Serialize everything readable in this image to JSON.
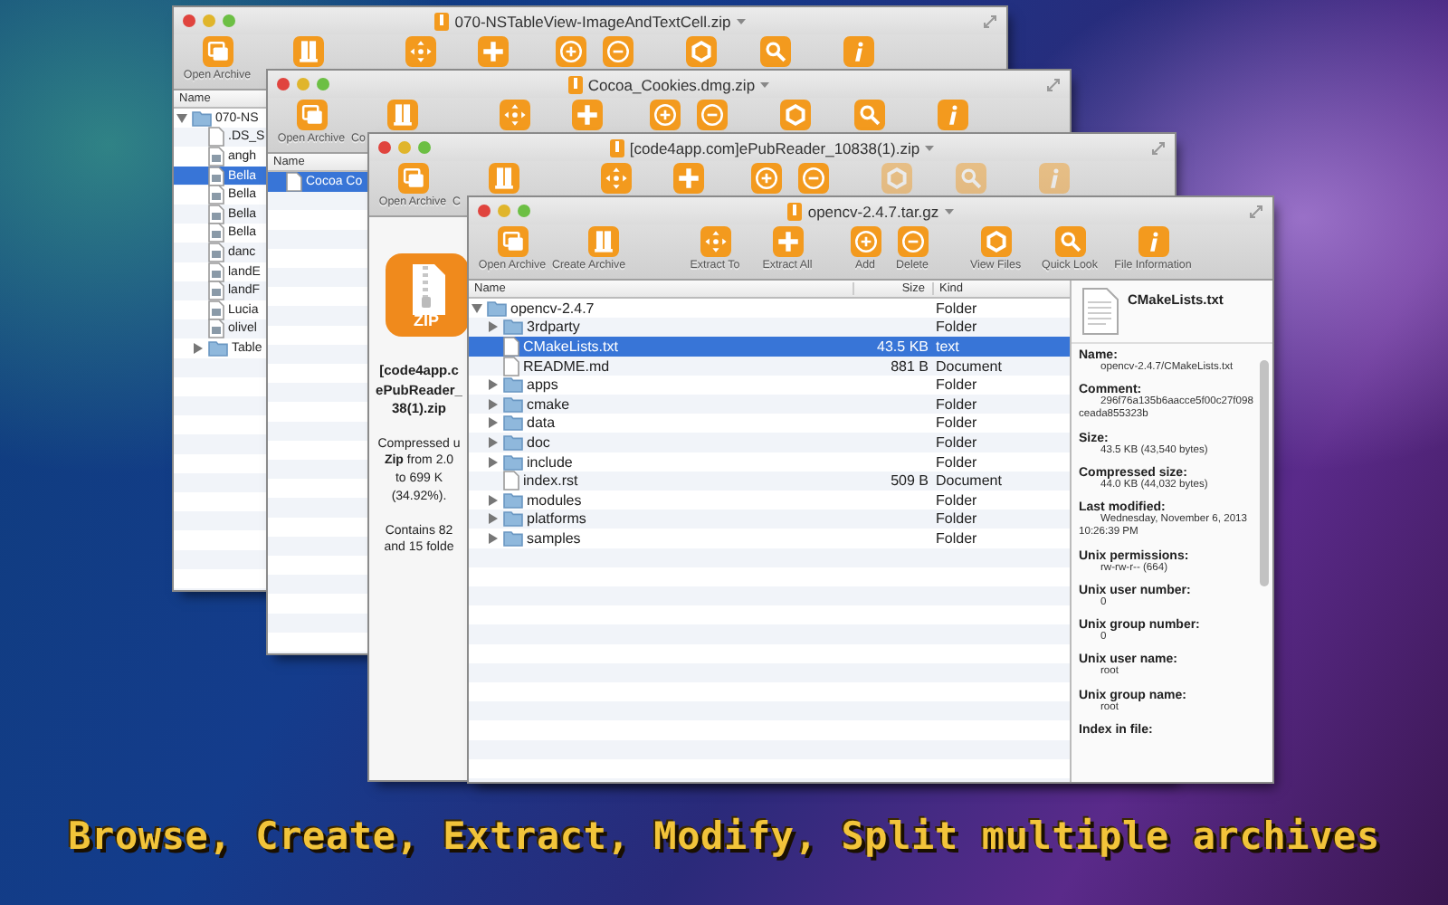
{
  "windows": [
    {
      "title": "070-NSTableView-ImageAndTextCell.zip",
      "toolbar": [
        [
          {
            "label": "Open Archive",
            "disabled": false
          },
          {
            "disabled": false
          }
        ],
        [
          {
            "disabled": false
          },
          {
            "disabled": false
          }
        ],
        [
          {
            "disabled": false
          },
          {
            "disabled": false
          }
        ],
        [
          {
            "disabled": false
          },
          {
            "disabled": false
          },
          {
            "disabled": false
          }
        ]
      ],
      "body": {
        "kind": "tree",
        "columns": [
          "Name"
        ],
        "rows": [
          {
            "name": "070-NS",
            "kind": "folder",
            "expanded": true,
            "selected": false,
            "children": [
              {
                "name": ".DS_S",
                "kind": "file",
                "selected": false
              },
              {
                "name": "angh",
                "kind": "image",
                "selected": false
              },
              {
                "name": "Bella",
                "kind": "image",
                "selected": true
              },
              {
                "name": "Bella",
                "kind": "image",
                "selected": false
              },
              {
                "name": "Bella",
                "kind": "image",
                "selected": false
              },
              {
                "name": "Bella",
                "kind": "image",
                "selected": false
              },
              {
                "name": "danc",
                "kind": "image",
                "selected": false
              },
              {
                "name": "landE",
                "kind": "image",
                "selected": false
              },
              {
                "name": "landF",
                "kind": "image",
                "selected": false
              },
              {
                "name": "Lucia",
                "kind": "image",
                "selected": false
              },
              {
                "name": "olivel",
                "kind": "image",
                "selected": false
              },
              {
                "name": "Table",
                "kind": "folder",
                "expanded": false,
                "selected": false
              }
            ]
          }
        ]
      }
    },
    {
      "title": "Cocoa_Cookies.dmg.zip",
      "toolbar": [
        [
          {
            "label": "Open Archive",
            "disabled": false
          },
          {
            "label": "Co",
            "disabled": false
          }
        ],
        [
          {
            "disabled": false
          },
          {
            "disabled": false
          }
        ],
        [
          {
            "disabled": false
          },
          {
            "disabled": false
          }
        ],
        [
          {
            "disabled": false
          },
          {
            "disabled": false
          },
          {
            "disabled": false
          }
        ]
      ],
      "body": {
        "kind": "tree",
        "columns": [
          "Name"
        ],
        "rows": [
          {
            "name": "Cocoa Co",
            "kind": "file",
            "selected": true
          }
        ]
      }
    },
    {
      "title": "[code4app.com]ePubReader_10838(1).zip",
      "toolbar": [
        [
          {
            "label": "Open Archive",
            "disabled": false
          },
          {
            "label": "C",
            "disabled": false
          }
        ],
        [
          {
            "disabled": false
          },
          {
            "disabled": false
          }
        ],
        [
          {
            "disabled": false
          },
          {
            "disabled": false
          }
        ],
        [
          {
            "disabled": true
          },
          {
            "disabled": true
          },
          {
            "disabled": true
          }
        ]
      ],
      "body": {
        "kind": "summary",
        "icon_label": "ZIP",
        "title_lines": [
          "[code4app.c",
          "ePubReader_",
          "38(1).zip"
        ],
        "paragraphs": [
          [
            "Compressed u",
            "**Zip** from 2.0",
            "to 699 K",
            "(34.92%)."
          ],
          [
            "Contains 82",
            "and 15 folde"
          ]
        ]
      }
    },
    {
      "title": "opencv-2.4.7.tar.gz",
      "toolbar": [
        [
          {
            "label": "Open Archive",
            "disabled": false
          },
          {
            "label": "Create Archive",
            "disabled": false
          }
        ],
        [
          {
            "label": "Extract To",
            "disabled": false
          },
          {
            "label": "Extract All",
            "disabled": false
          }
        ],
        [
          {
            "label": "Add",
            "disabled": false
          },
          {
            "label": "Delete",
            "disabled": false
          }
        ],
        [
          {
            "label": "View Files",
            "disabled": false
          },
          {
            "label": "Quick Look",
            "disabled": false
          },
          {
            "label": "File Information",
            "disabled": false
          }
        ]
      ],
      "body": {
        "kind": "browser",
        "columns": [
          "Name",
          "Size",
          "Kind"
        ],
        "rows": [
          {
            "name": "opencv-2.4.7",
            "kind": "folder",
            "expanded": true,
            "selected": false,
            "kind_text": "Folder",
            "children": [
              {
                "name": "3rdparty",
                "kind": "folder",
                "expanded": false,
                "selected": false,
                "kind_text": "Folder"
              },
              {
                "name": "CMakeLists.txt",
                "kind": "file",
                "selected": true,
                "size": "43.5 KB",
                "kind_text": "text"
              },
              {
                "name": "README.md",
                "kind": "file",
                "selected": false,
                "size": "881 B",
                "kind_text": "Document"
              },
              {
                "name": "apps",
                "kind": "folder",
                "expanded": false,
                "selected": false,
                "kind_text": "Folder"
              },
              {
                "name": "cmake",
                "kind": "folder",
                "expanded": false,
                "selected": false,
                "kind_text": "Folder"
              },
              {
                "name": "data",
                "kind": "folder",
                "expanded": false,
                "selected": false,
                "kind_text": "Folder"
              },
              {
                "name": "doc",
                "kind": "folder",
                "expanded": false,
                "selected": false,
                "kind_text": "Folder"
              },
              {
                "name": "include",
                "kind": "folder",
                "expanded": false,
                "selected": false,
                "kind_text": "Folder"
              },
              {
                "name": "index.rst",
                "kind": "file",
                "selected": false,
                "size": "509 B",
                "kind_text": "Document"
              },
              {
                "name": "modules",
                "kind": "folder",
                "expanded": false,
                "selected": false,
                "kind_text": "Folder"
              },
              {
                "name": "platforms",
                "kind": "folder",
                "expanded": false,
                "selected": false,
                "kind_text": "Folder"
              },
              {
                "name": "samples",
                "kind": "folder",
                "expanded": false,
                "selected": false,
                "kind_text": "Folder"
              }
            ]
          }
        ],
        "info": {
          "file_name": "CMakeLists.txt",
          "fields": [
            {
              "label": "Name:",
              "value": "opencv-2.4.7/CMakeLists.txt"
            },
            {
              "label": "Comment:",
              "value": "296f76a135b6aacce5f00c27f098ceada855323b"
            },
            {
              "label": "Size:",
              "value": "43.5 KB (43,540 bytes)"
            },
            {
              "label": "Compressed size:",
              "value": "44.0 KB (44,032 bytes)"
            },
            {
              "label": "Last modified:",
              "value": "Wednesday, November 6, 2013 10:26:39 PM"
            },
            {
              "label": "Unix permissions:",
              "value": "rw-rw-r-- (664)"
            },
            {
              "label": "Unix user number:",
              "value": "0"
            },
            {
              "label": "Unix group number:",
              "value": "0"
            },
            {
              "label": "Unix user name:",
              "value": "root"
            },
            {
              "label": "Unix group name:",
              "value": "root"
            },
            {
              "label": "Index in file:"
            }
          ]
        }
      }
    }
  ],
  "caption": "Browse, Create, Extract, Modify, Split multiple archives"
}
